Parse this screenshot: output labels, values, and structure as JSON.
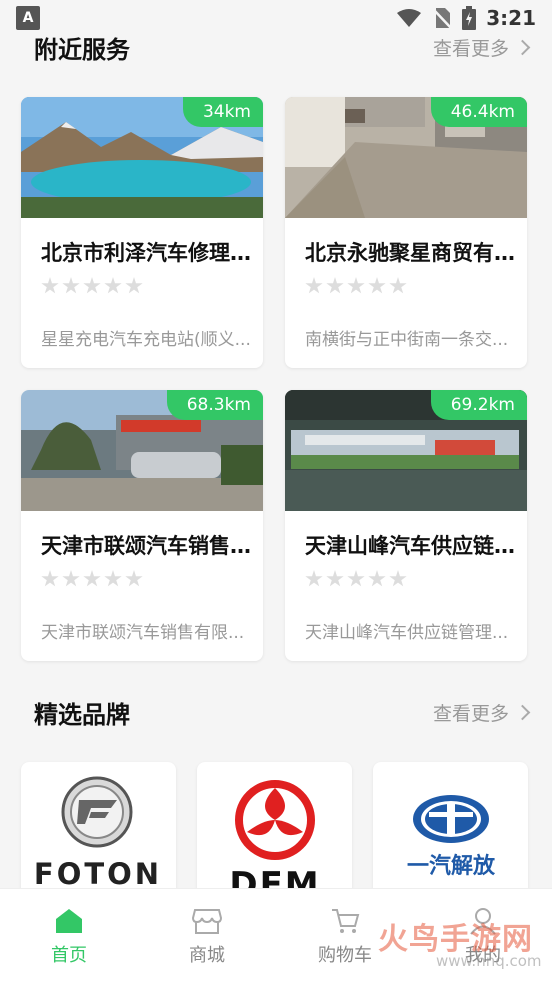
{
  "status_bar": {
    "time": "3:21",
    "left_badge": "A"
  },
  "nearby": {
    "title": "附近服务",
    "more_label": "查看更多",
    "cards": [
      {
        "distance": "34km",
        "name": "北京市利泽汽车修理...",
        "address": "星星充电汽车充电站(顺义...",
        "rating": 0
      },
      {
        "distance": "46.4km",
        "name": "北京永驰聚星商贸有...",
        "address": "南横街与正中街南一条交...",
        "rating": 0
      },
      {
        "distance": "68.3km",
        "name": "天津市联颂汽车销售...",
        "address": "天津市联颂汽车销售有限...",
        "rating": 0
      },
      {
        "distance": "69.2km",
        "name": "天津山峰汽车供应链...",
        "address": "天津山峰汽车供应链管理...",
        "rating": 0
      }
    ]
  },
  "brands": {
    "title": "精选品牌",
    "more_label": "查看更多",
    "items": [
      {
        "logo_text": "FOTON"
      },
      {
        "logo_text": "DFM"
      },
      {
        "logo_text": "一汽解放"
      }
    ]
  },
  "tabbar": {
    "tabs": [
      {
        "label": "首页",
        "icon": "home-icon",
        "active": true
      },
      {
        "label": "商城",
        "icon": "store-icon",
        "active": false
      },
      {
        "label": "购物车",
        "icon": "cart-icon",
        "active": false
      },
      {
        "label": "我的",
        "icon": "user-icon",
        "active": false
      }
    ]
  },
  "watermark": {
    "text": "火鸟手游网",
    "sub": "www.hnq.com"
  },
  "colors": {
    "accent": "#33c766",
    "background": "#f5f5f5"
  }
}
